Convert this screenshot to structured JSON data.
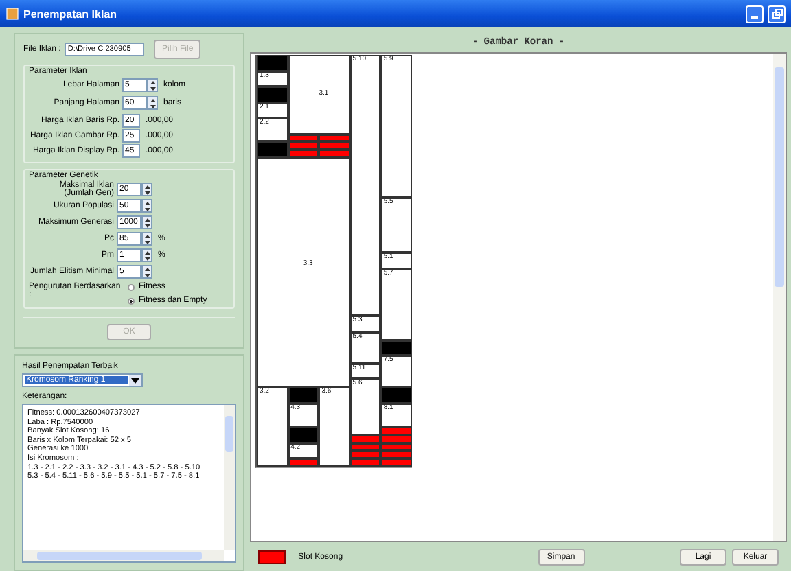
{
  "window": {
    "title": "Penempatan Iklan"
  },
  "file": {
    "label": "File Iklan :",
    "value": "D:\\Drive C 230905",
    "button": {
      "label": "Pilih File",
      "disabled": true
    }
  },
  "ad_params": {
    "title": "Parameter Iklan",
    "fields": [
      {
        "label": "Lebar Halaman",
        "value": "5",
        "unit": "kolom",
        "kind": "spin"
      },
      {
        "label": "Panjang Halaman",
        "value": "60",
        "unit": "baris",
        "kind": "spin"
      },
      {
        "label": "Harga Iklan Baris Rp.",
        "value": "20",
        "unit": ".000,00",
        "kind": "text"
      },
      {
        "label": "Harga Iklan Gambar Rp.",
        "value": "25",
        "unit": ".000,00",
        "kind": "text"
      },
      {
        "label": "Harga Iklan Display Rp.",
        "value": "45",
        "unit": ".000,00",
        "kind": "text"
      }
    ]
  },
  "genetic_params": {
    "title": "Parameter Genetik",
    "fields": [
      {
        "label": "Maksimal Iklan\n(Jumlah Gen)",
        "value": "20",
        "kind": "spin"
      },
      {
        "label": "Ukuran Populasi",
        "value": "50",
        "kind": "spin"
      },
      {
        "label": "Maksimum Generasi",
        "value": "1000",
        "kind": "spin"
      },
      {
        "label": "Pc",
        "value": "85",
        "unit": "%",
        "kind": "spin"
      },
      {
        "label": "Pm",
        "value": "1",
        "unit": "%",
        "kind": "spin"
      },
      {
        "label": "Jumlah Elitism Minimal",
        "value": "5",
        "kind": "spin"
      }
    ],
    "sort": {
      "label": "Pengurutan Berdasarkan :",
      "options": [
        {
          "label": "Fitness",
          "selected": false
        },
        {
          "label": "Fitness dan Empty",
          "selected": true
        }
      ]
    }
  },
  "ok_button": {
    "label": "OK",
    "disabled": true
  },
  "result": {
    "title": "Hasil Penempatan Terbaik",
    "combo": "Kromosom Ranking 1",
    "notes_label": "Keterangan:",
    "notes": [
      "Fitness: 0.000132600407373027",
      "Laba : Rp.7540000",
      "Banyak Slot Kosong: 16",
      "Baris x Kolom Terpakai: 52 x 5",
      "Generasi ke 1000",
      "Isi Kromosom :",
      "1.3 - 2.1 - 2.2 - 3.3 - 3.2 - 3.1 - 4.3 - 5.2 - 5.8 - 5.10",
      "5.3 - 5.4 - 5.11 - 5.6 - 5.9 - 5.5 - 5.1 - 5.7 - 7.5 - 8.1"
    ]
  },
  "newspaper": {
    "title": "- Gambar Koran -",
    "blocks": [
      {
        "kind": "filled"
      },
      {
        "kind": "ad",
        "label": "1.3"
      },
      {
        "kind": "filled"
      },
      {
        "kind": "ad",
        "label": "2.1"
      },
      {
        "kind": "ad",
        "label": "2.2"
      },
      {
        "kind": "filled"
      },
      {
        "kind": "ad",
        "label": "3.1"
      },
      {
        "kind": "empty"
      },
      {
        "kind": "empty"
      },
      {
        "kind": "empty"
      },
      {
        "kind": "empty"
      },
      {
        "kind": "empty"
      },
      {
        "kind": "empty"
      },
      {
        "kind": "ad",
        "label": "3.3"
      },
      {
        "kind": "ad",
        "label": "3.2"
      },
      {
        "kind": "filled"
      },
      {
        "kind": "ad",
        "label": "4.3"
      },
      {
        "kind": "filled"
      },
      {
        "kind": "ad",
        "label": "4.2"
      },
      {
        "kind": "empty"
      },
      {
        "kind": "ad",
        "label": "3.6"
      },
      {
        "kind": "ad",
        "label": "5.10"
      },
      {
        "kind": "ad",
        "label": "5.3"
      },
      {
        "kind": "ad",
        "label": "5.4"
      },
      {
        "kind": "ad",
        "label": "5.11"
      },
      {
        "kind": "ad",
        "label": "5.6"
      },
      {
        "kind": "empty"
      },
      {
        "kind": "empty"
      },
      {
        "kind": "empty"
      },
      {
        "kind": "empty"
      },
      {
        "kind": "ad",
        "label": "5.9"
      },
      {
        "kind": "ad",
        "label": "5.5"
      },
      {
        "kind": "ad",
        "label": "5.1"
      },
      {
        "kind": "ad",
        "label": "5.7"
      },
      {
        "kind": "filled"
      },
      {
        "kind": "ad",
        "label": "7.5"
      },
      {
        "kind": "filled"
      },
      {
        "kind": "ad",
        "label": "8.1"
      },
      {
        "kind": "empty"
      },
      {
        "kind": "empty"
      },
      {
        "kind": "empty"
      },
      {
        "kind": "empty"
      },
      {
        "kind": "empty"
      }
    ]
  },
  "legend": {
    "label": "= Slot Kosong"
  },
  "buttons": [
    "Simpan",
    "Lagi",
    "Keluar"
  ]
}
